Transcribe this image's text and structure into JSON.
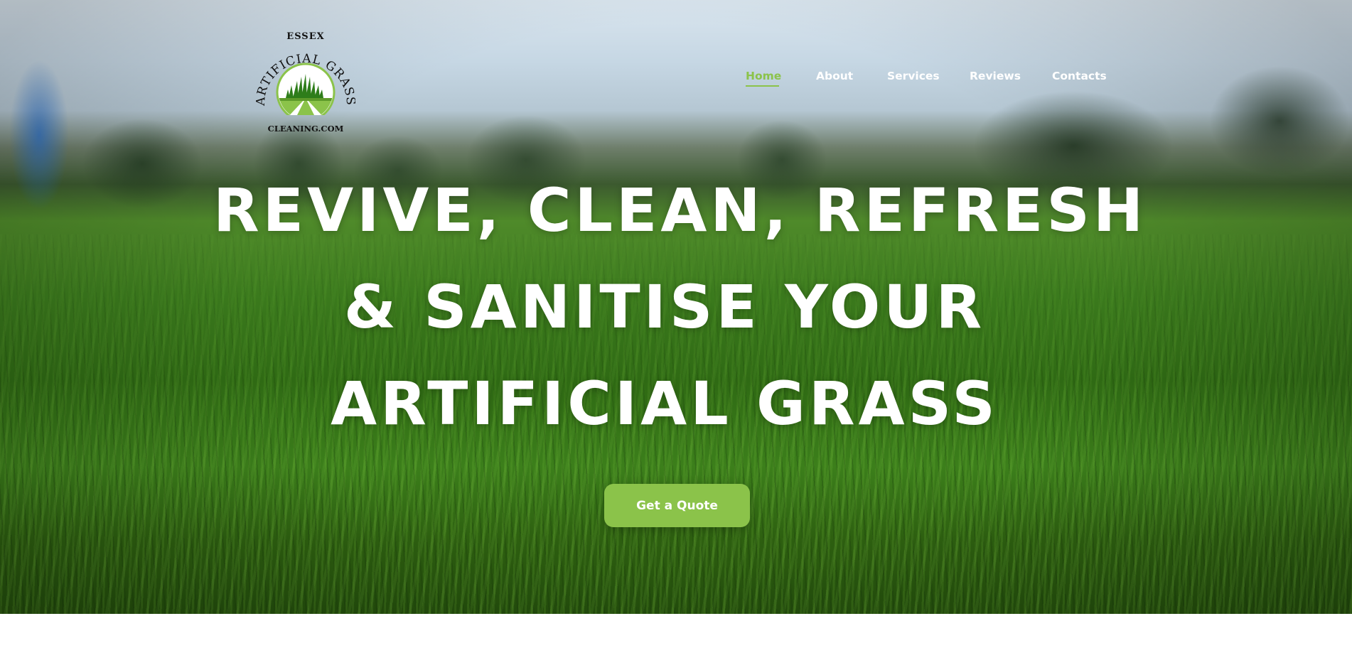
{
  "brand": {
    "logo_top": "ESSEX",
    "logo_arc": "ARTIFICIAL GRASS",
    "logo_bottom": "CLEANING.COM",
    "accent_color": "#8bc34a"
  },
  "nav": {
    "items": [
      {
        "label": "Home",
        "active": true
      },
      {
        "label": "About",
        "active": false
      },
      {
        "label": "Services",
        "active": false
      },
      {
        "label": "Reviews",
        "active": false
      },
      {
        "label": "Contacts",
        "active": false
      }
    ]
  },
  "hero": {
    "headline_lines": [
      "REVIVE, CLEAN, REFRESH",
      "& SANITISE YOUR",
      "ARTIFICIAL GRASS"
    ],
    "cta_label": "Get a Quote"
  }
}
